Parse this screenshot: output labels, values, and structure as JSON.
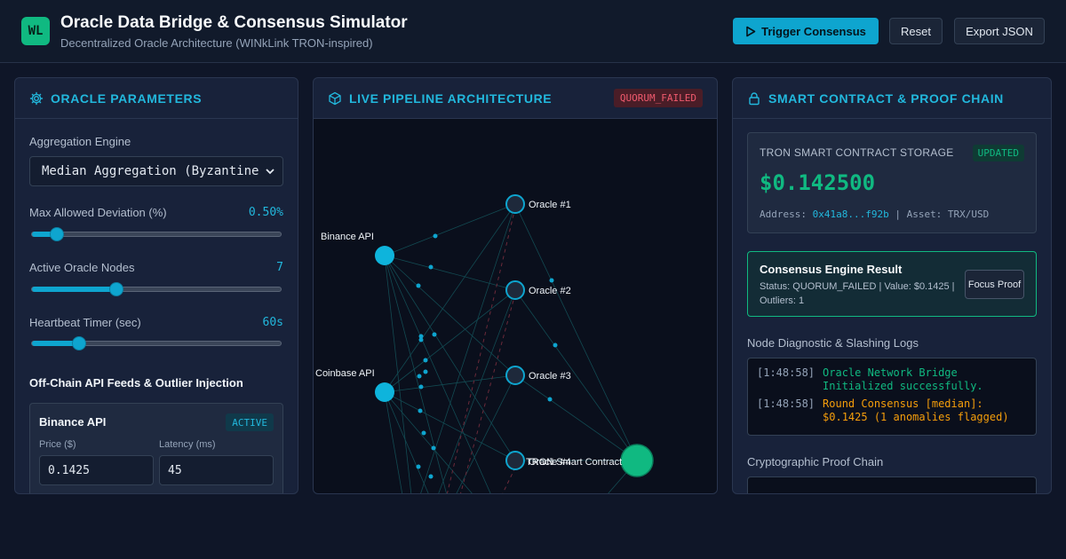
{
  "header": {
    "logo": "WL",
    "title": "Oracle Data Bridge & Consensus Simulator",
    "subtitle": "Decentralized Oracle Architecture (WINkLink TRON-inspired)",
    "trigger_label": "Trigger Consensus",
    "reset_label": "Reset",
    "export_label": "Export JSON"
  },
  "params": {
    "title": "ORACLE PARAMETERS",
    "engine_label": "Aggregation Engine",
    "engine_value": "Median Aggregation (Byzantine",
    "deviation_label": "Max Allowed Deviation (%)",
    "deviation_value": "0.50%",
    "deviation_fraction": 0.1,
    "nodes_label": "Active Oracle Nodes",
    "nodes_value": "7",
    "nodes_fraction": 0.34,
    "heartbeat_label": "Heartbeat Timer (sec)",
    "heartbeat_value": "60s",
    "heartbeat_fraction": 0.19,
    "feeds_title": "Off-Chain API Feeds & Outlier Injection",
    "feed": {
      "name": "Binance API",
      "status": "ACTIVE",
      "price_label": "Price ($)",
      "price_value": "0.1425",
      "latency_label": "Latency (ms)",
      "latency_value": "45"
    }
  },
  "pipeline": {
    "title": "LIVE PIPELINE ARCHITECTURE",
    "status": "QUORUM_FAILED",
    "sources": [
      "Binance API",
      "Coinbase API"
    ],
    "oracles": [
      "Oracle #1",
      "Oracle #2",
      "Oracle #3",
      "Oracle #4"
    ],
    "contract_label": "TRON Smart Contract"
  },
  "contract": {
    "title": "SMART CONTRACT & PROOF CHAIN",
    "storage_label": "TRON SMART CONTRACT STORAGE",
    "badge": "UPDATED",
    "price": "$0.142500",
    "address_label": "Address:",
    "address": "0x41a8...f92b",
    "asset": "| Asset: TRX/USD"
  },
  "result": {
    "title": "Consensus Engine Result",
    "status_text": "Status: QUORUM_FAILED | Value: $0.1425 | Outliers: 1",
    "focus_label": "Focus Proof"
  },
  "logs": {
    "title": "Node Diagnostic & Slashing Logs",
    "entries": [
      {
        "time": "[1:48:58]",
        "text": "Oracle Network Bridge Initialized successfully."
      },
      {
        "time": "[1:48:58]",
        "text": "Round Consensus [median]: $0.1425 (1 anomalies flagged)"
      }
    ]
  },
  "proof": {
    "title": "Cryptographic Proof Chain"
  },
  "colors": {
    "accent": "#22b8dd",
    "success": "#10b981",
    "danger": "#f05a6e",
    "warning": "#f59e0b"
  }
}
